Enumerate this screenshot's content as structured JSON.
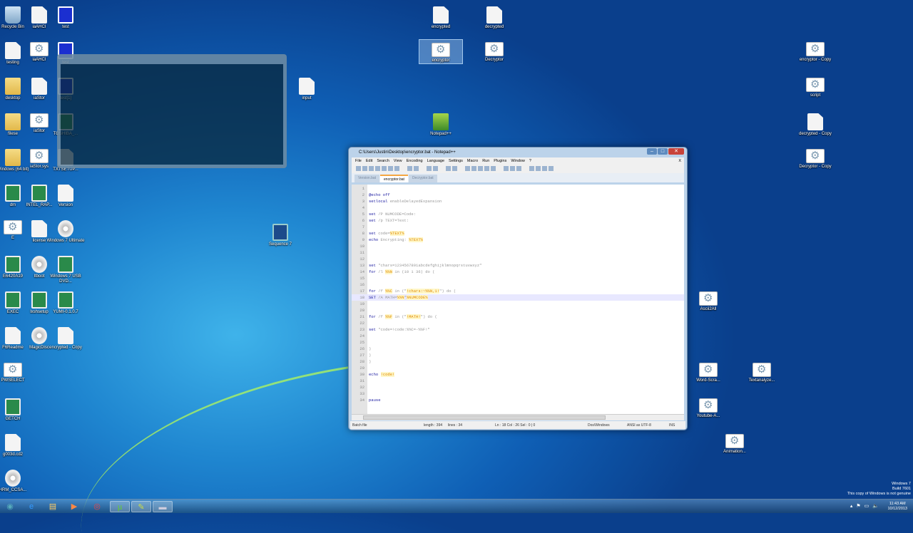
{
  "desktop_icons": [
    {
      "label": "Recycle Bin",
      "type": "bin"
    },
    {
      "label": "testing",
      "type": "file"
    },
    {
      "label": "desktop",
      "type": "folder"
    },
    {
      "label": "filese",
      "type": "folder"
    },
    {
      "label": "Windows (64 bit)",
      "type": "folder"
    },
    {
      "label": "dm",
      "type": "app"
    },
    {
      "label": "E",
      "type": "gear"
    },
    {
      "label": "E6420A19",
      "type": "app"
    },
    {
      "label": "EXEC",
      "type": "app"
    },
    {
      "label": "F6Readme",
      "type": "file"
    },
    {
      "label": "PWSELECT",
      "type": "gear"
    },
    {
      "label": "GETCH",
      "type": "app"
    },
    {
      "label": "g003d.cd2",
      "type": "file"
    },
    {
      "label": "HRM_CCSA...",
      "type": "disc"
    },
    {
      "label": "iaAHCI",
      "type": "file"
    },
    {
      "label": "iaAHCI",
      "type": "gear"
    },
    {
      "label": "iaStor",
      "type": "file"
    },
    {
      "label": "iaStor",
      "type": "gear"
    },
    {
      "label": "iaStor.sys",
      "type": "gear"
    },
    {
      "label": "INTEL_RAP...",
      "type": "app"
    },
    {
      "label": "license",
      "type": "file"
    },
    {
      "label": "ltboot",
      "type": "disc"
    },
    {
      "label": "lxshsetup",
      "type": "app"
    },
    {
      "label": "MagicDisc",
      "type": "disc"
    },
    {
      "label": "test",
      "type": "monitor"
    },
    {
      "label": "test",
      "type": "monitor"
    },
    {
      "label": "test[1]",
      "type": "monitor"
    },
    {
      "label": "TOSHIBA_...",
      "type": "app"
    },
    {
      "label": "TXTSETUP...",
      "type": "file"
    },
    {
      "label": "Version",
      "type": "file"
    },
    {
      "label": "Windows 7 Ultimate",
      "type": "disc"
    },
    {
      "label": "Windows 7 USB DVD...",
      "type": "app"
    },
    {
      "label": "YUMI-0.1.0.7",
      "type": "app"
    },
    {
      "label": "encrypted - Copy",
      "type": "file"
    },
    {
      "label": "input",
      "type": "file"
    },
    {
      "label": "Sequence 7",
      "type": "seq"
    },
    {
      "label": "encrypted",
      "type": "file"
    },
    {
      "label": "decrypted",
      "type": "file"
    },
    {
      "label": "encryptor",
      "type": "gear",
      "selected": true
    },
    {
      "label": "Decryptor",
      "type": "gear"
    },
    {
      "label": "Notepad++",
      "type": "np"
    },
    {
      "label": "encryptor - Copy",
      "type": "gear"
    },
    {
      "label": "script",
      "type": "gear"
    },
    {
      "label": "decrypted - Copy",
      "type": "file"
    },
    {
      "label": "Decryptor - Copy",
      "type": "gear"
    },
    {
      "label": "Ascii2All",
      "type": "gear"
    },
    {
      "label": "Word-Scra...",
      "type": "gear"
    },
    {
      "label": "Textanalyze...",
      "type": "gear"
    },
    {
      "label": "Youtube-A...",
      "type": "gear"
    },
    {
      "label": "Animation...",
      "type": "gear"
    }
  ],
  "notepad": {
    "title": "C:\\Users\\Justin\\Desktop\\encryptor.bat - Notepad++",
    "menu": [
      "File",
      "Edit",
      "Search",
      "View",
      "Encoding",
      "Language",
      "Settings",
      "Macro",
      "Run",
      "Plugins",
      "Window",
      "?"
    ],
    "menu_close": "X",
    "tabs": [
      {
        "label": "Version.bat"
      },
      {
        "label": "encryptor.bat",
        "active": true
      },
      {
        "label": "Decryptor.bat"
      }
    ],
    "current_line": 18,
    "lines": [
      [],
      [
        [
          "k",
          "@echo off"
        ]
      ],
      [
        [
          "k",
          "setlocal"
        ],
        [
          "o",
          " enableDelayedExpansion"
        ]
      ],
      [],
      [
        [
          "k",
          "set"
        ],
        [
          "o",
          " /P NUMCODE=Code:"
        ]
      ],
      [
        [
          "k",
          "set"
        ],
        [
          "o",
          " /p TEXT=Text:"
        ]
      ],
      [],
      [
        [
          "k",
          "set"
        ],
        [
          "o",
          " code="
        ],
        [
          "v",
          "%TEXT%"
        ]
      ],
      [
        [
          "k",
          "echo"
        ],
        [
          "o",
          " Encrypting: "
        ],
        [
          "v",
          "%TEXT%"
        ]
      ],
      [],
      [],
      [],
      [
        [
          "k",
          "set"
        ],
        [
          "o",
          " \"chars=1234567891abcdefghijklmnopqrstuvwxyz\""
        ]
      ],
      [
        [
          "k",
          "for"
        ],
        [
          "o",
          " /l "
        ],
        [
          "v",
          "%%N"
        ],
        [
          "o",
          " in (10 1 36) do ("
        ]
      ],
      [],
      [],
      [
        [
          "k",
          "for"
        ],
        [
          "o",
          " /f "
        ],
        [
          "v",
          "%%C"
        ],
        [
          "o",
          " in (\""
        ],
        [
          "v",
          "!chars:~%%N,1!"
        ],
        [
          "o",
          "\") do ("
        ]
      ],
      [
        [
          "k",
          "SET"
        ],
        [
          "o",
          " /A MATH="
        ],
        [
          "v",
          "%%N"
        ],
        [
          "o",
          "*"
        ],
        [
          "v",
          "%NUMCODE%"
        ]
      ],
      [],
      [],
      [
        [
          "k",
          "for"
        ],
        [
          "o",
          " /f "
        ],
        [
          "v",
          "%%F"
        ],
        [
          "o",
          " in (\""
        ],
        [
          "v",
          "!MATH!"
        ],
        [
          "o",
          "\") do ("
        ]
      ],
      [],
      [
        [
          "k",
          "set"
        ],
        [
          "o",
          " \"code=!code:%%C=-%%F!\""
        ]
      ],
      [],
      [],
      [
        [
          "o",
          ")"
        ]
      ],
      [
        [
          "o",
          ")"
        ]
      ],
      [
        [
          "o",
          ")"
        ]
      ],
      [],
      [
        [
          "k",
          "echo"
        ],
        [
          "o",
          " "
        ],
        [
          "v",
          "!code!"
        ]
      ],
      [],
      [],
      [],
      [
        [
          "k",
          "pause"
        ]
      ]
    ],
    "status": {
      "type": "Batch file",
      "length": "length : 394",
      "lines": "lines : 34",
      "pos": "Ln : 18   Col : 26   Sel : 0 | 0",
      "eol": "Dos\\Windows",
      "encoding": "ANSI as UTF-8",
      "mode": "INS"
    }
  },
  "taskbar": {
    "items": [
      {
        "icon": "start-orb-icon"
      },
      {
        "icon": "internet-explorer-icon"
      },
      {
        "icon": "explorer-folder-icon"
      },
      {
        "icon": "media-player-icon"
      },
      {
        "icon": "chrome-icon"
      },
      {
        "icon": "utorrent-icon",
        "active": true
      },
      {
        "icon": "notepadpp-icon",
        "active": true
      },
      {
        "icon": "cmd-window-icon",
        "active": true
      }
    ]
  },
  "watermark": {
    "line1": "Windows 7",
    "line2": "Build 7601",
    "line3": "This copy of Windows is not genuine"
  },
  "clock": {
    "time": "11:43 AM",
    "date": "10/12/2013"
  }
}
